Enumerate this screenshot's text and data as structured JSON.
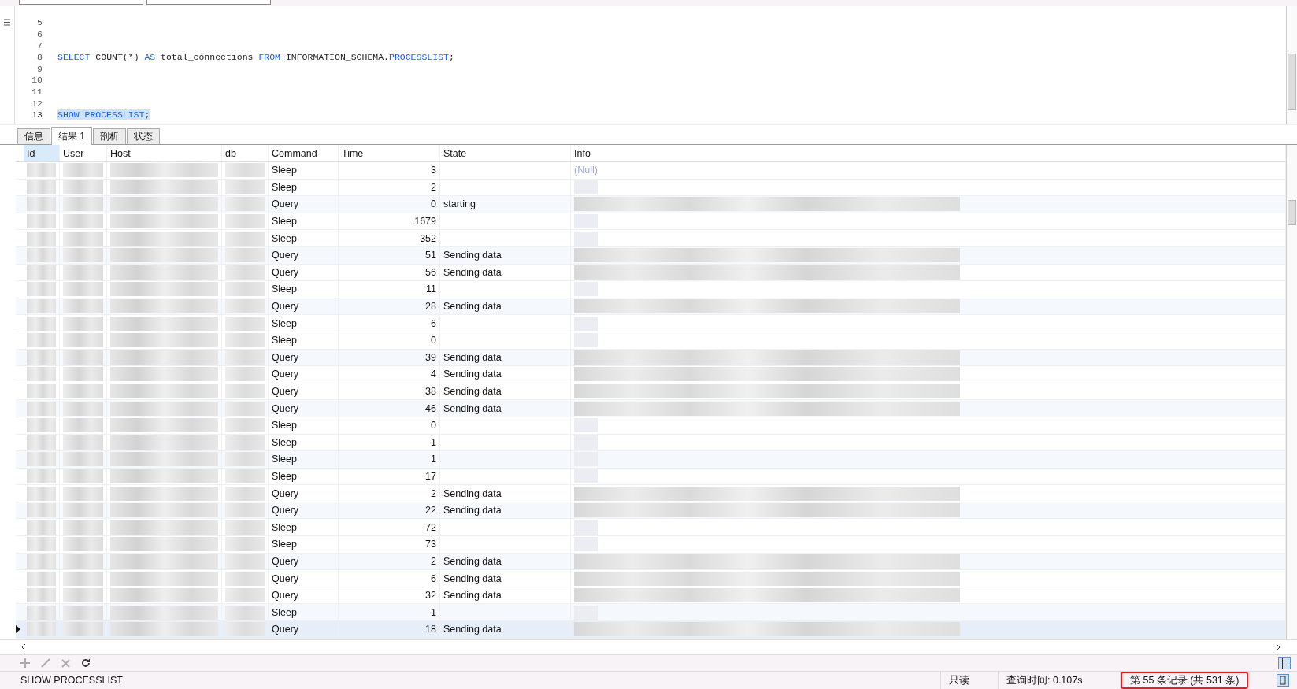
{
  "editor": {
    "lines": [
      {
        "number": "5",
        "selected": false
      },
      {
        "number": "6",
        "selected": false
      },
      {
        "number": "7",
        "selected": false
      },
      {
        "number": "8",
        "selected": false,
        "tokens": [
          {
            "text": "SELECT",
            "kind": "keyword"
          },
          {
            "text": " COUNT(*) ",
            "kind": "plain"
          },
          {
            "text": "AS",
            "kind": "keyword"
          },
          {
            "text": " total_connections ",
            "kind": "plain"
          },
          {
            "text": "FROM",
            "kind": "keyword"
          },
          {
            "text": " INFORMATION_SCHEMA.",
            "kind": "plain"
          },
          {
            "text": "PROCESSLIST",
            "kind": "keyword"
          },
          {
            "text": ";",
            "kind": "plain"
          }
        ]
      },
      {
        "number": "9",
        "selected": false
      },
      {
        "number": "10",
        "selected": false
      },
      {
        "number": "11",
        "selected": false
      },
      {
        "number": "12",
        "selected": false
      },
      {
        "number": "13",
        "selected": true,
        "tokens": [
          {
            "text": "SHOW PROCESSLIST",
            "kind": "keyword"
          },
          {
            "text": ";",
            "kind": "plain"
          }
        ]
      }
    ]
  },
  "tabs": [
    {
      "label": "信息",
      "selected": false
    },
    {
      "label": "结果 1",
      "selected": true
    },
    {
      "label": "剖析",
      "selected": false
    },
    {
      "label": "状态",
      "selected": false
    }
  ],
  "table": {
    "columns": [
      {
        "label": "Id",
        "selected": true
      },
      {
        "label": "User",
        "selected": false
      },
      {
        "label": "Host",
        "selected": false
      },
      {
        "label": "db",
        "selected": false
      },
      {
        "label": "Command",
        "selected": false
      },
      {
        "label": "Time",
        "selected": false
      },
      {
        "label": "State",
        "selected": false
      },
      {
        "label": "Info",
        "selected": false
      }
    ],
    "rows": [
      {
        "command": "Sleep",
        "time": "3",
        "info": "(Null)",
        "current": false
      },
      {
        "command": "Sleep",
        "time": "2",
        "current": false
      },
      {
        "command": "Query",
        "time": "0",
        "state": "starting",
        "current": false
      },
      {
        "command": "Sleep",
        "time": "1679",
        "current": false
      },
      {
        "command": "Sleep",
        "time": "352",
        "current": false
      },
      {
        "command": "Query",
        "time": "51",
        "state": "Sending data",
        "current": false
      },
      {
        "command": "Query",
        "time": "56",
        "state": "Sending data",
        "current": false
      },
      {
        "command": "Sleep",
        "time": "11",
        "current": false
      },
      {
        "command": "Query",
        "time": "28",
        "state": "Sending data",
        "current": false
      },
      {
        "command": "Sleep",
        "time": "6",
        "current": false
      },
      {
        "command": "Sleep",
        "time": "0",
        "current": false
      },
      {
        "command": "Query",
        "time": "39",
        "state": "Sending data",
        "current": false
      },
      {
        "command": "Query",
        "time": "4",
        "state": "Sending data",
        "current": false
      },
      {
        "command": "Query",
        "time": "38",
        "state": "Sending data",
        "current": false
      },
      {
        "command": "Query",
        "time": "46",
        "state": "Sending data",
        "current": false
      },
      {
        "command": "Sleep",
        "time": "0",
        "current": false
      },
      {
        "command": "Sleep",
        "time": "1",
        "current": false
      },
      {
        "command": "Sleep",
        "time": "1",
        "current": false
      },
      {
        "command": "Sleep",
        "time": "17",
        "current": false
      },
      {
        "command": "Query",
        "time": "2",
        "state": "Sending data",
        "current": false
      },
      {
        "command": "Query",
        "time": "22",
        "state": "Sending data",
        "current": false
      },
      {
        "command": "Sleep",
        "time": "72",
        "current": false
      },
      {
        "command": "Sleep",
        "time": "73",
        "current": false
      },
      {
        "command": "Query",
        "time": "2",
        "state": "Sending data",
        "current": false
      },
      {
        "command": "Query",
        "time": "6",
        "state": "Sending data",
        "current": false
      },
      {
        "command": "Query",
        "time": "32",
        "state": "Sending data",
        "current": false
      },
      {
        "command": "Sleep",
        "time": "1",
        "current": false
      },
      {
        "command": "Query",
        "time": "18",
        "state": "Sending data",
        "current": true
      }
    ]
  },
  "status_bar": [
    {
      "text": "SHOW PROCESSLIST",
      "highlighted": false
    },
    {
      "text": "只读",
      "highlighted": false
    },
    {
      "text": "查询时间: 0.107s",
      "highlighted": false
    },
    {
      "text": "第 55 条记录 (共 531 条)",
      "highlighted": true
    }
  ]
}
